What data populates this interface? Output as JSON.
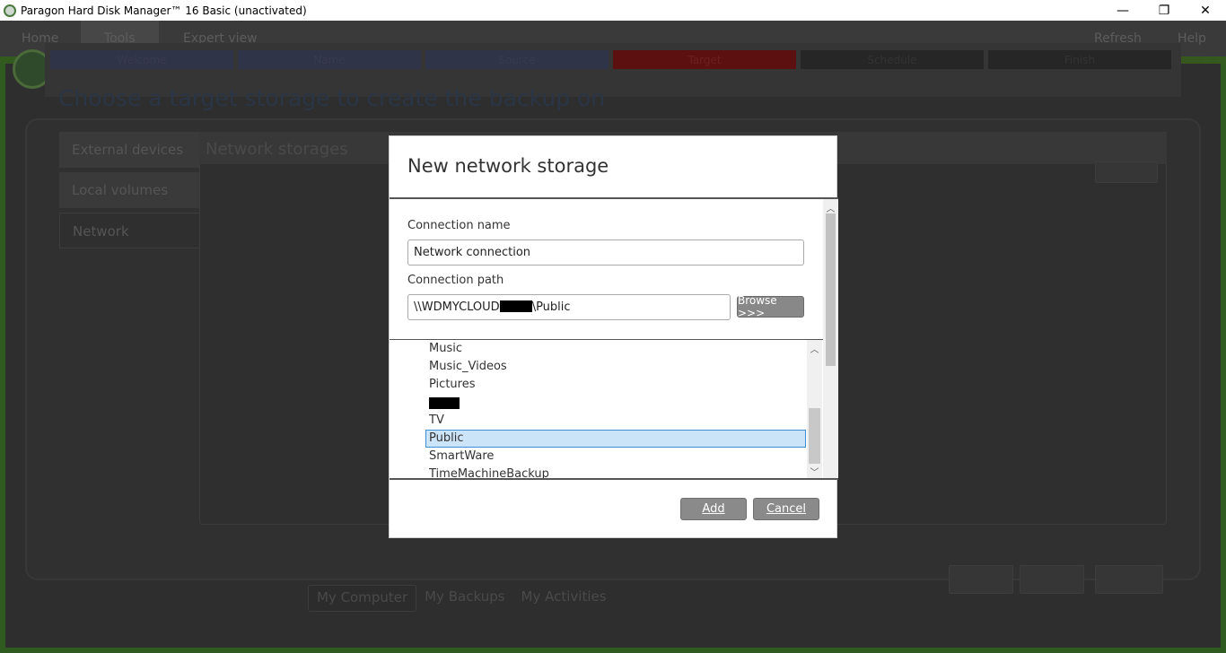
{
  "window": {
    "title": "Paragon Hard Disk Manager™ 16 Basic (unactivated)",
    "minimize": "—",
    "restore": "❐",
    "close": "✕"
  },
  "menubar": {
    "items": [
      "Home",
      "Tools",
      "Expert view"
    ],
    "right_items": [
      "Refresh",
      "Help"
    ]
  },
  "wizard": {
    "steps": [
      "Welcome",
      "Name",
      "Source",
      "Target",
      "Schedule",
      "Finish"
    ],
    "heading": "Choose a target storage to create the backup on"
  },
  "sidebar": {
    "tabs": [
      "External devices",
      "Local volumes",
      "Network"
    ]
  },
  "content": {
    "title": "Network storages"
  },
  "bottom_tabs": [
    "My Computer",
    "My Backups",
    "My Activities"
  ],
  "dialog": {
    "title": "New network storage",
    "connection_name_label": "Connection name",
    "connection_name_value": "Network connection",
    "connection_path_label": "Connection path",
    "connection_path_prefix": "\\\\WDMYCLOUD",
    "connection_path_suffix": "\\Public",
    "browse_label": "Browse >>>",
    "tree_items": [
      "Music",
      "Music_Videos",
      "Pictures",
      "",
      "TV",
      "Public",
      "SmartWare",
      "TimeMachineBackup"
    ],
    "selected_item": "Public",
    "add_label": "Add",
    "cancel_label": "Cancel"
  }
}
